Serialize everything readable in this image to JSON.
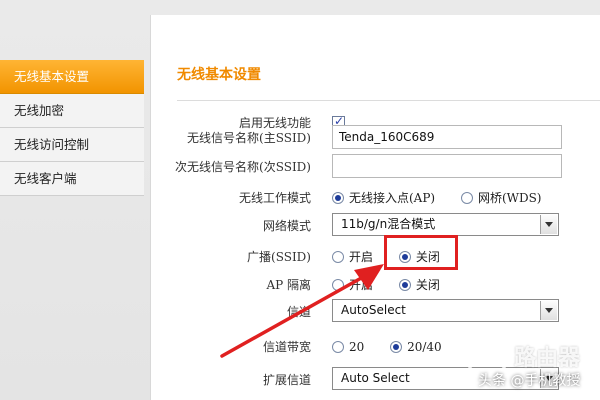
{
  "sidebar": {
    "items": [
      {
        "label": "无线基本设置",
        "active": true
      },
      {
        "label": "无线加密"
      },
      {
        "label": "无线访问控制"
      },
      {
        "label": "无线客户端"
      }
    ]
  },
  "main": {
    "title": "无线基本设置",
    "fields": {
      "enable_wireless": {
        "label": "启用无线功能",
        "checked": true
      },
      "ssid_primary": {
        "label": "无线信号名称(主SSID)",
        "value": "Tenda_160C689"
      },
      "ssid_secondary": {
        "label": "次无线信号名称(次SSID)",
        "value": ""
      },
      "work_mode": {
        "label": "无线工作模式",
        "options": [
          "无线接入点(AP)",
          "网桥(WDS)"
        ],
        "selected": "无线接入点(AP)"
      },
      "network_mode": {
        "label": "网络模式",
        "value": "11b/g/n混合模式"
      },
      "broadcast": {
        "label": "广播(SSID)",
        "options": [
          "开启",
          "关闭"
        ],
        "selected": "关闭"
      },
      "ap_isolation": {
        "label": "AP 隔离",
        "options": [
          "开启",
          "关闭"
        ],
        "selected": "关闭"
      },
      "channel": {
        "label": "信道",
        "value": "AutoSelect"
      },
      "bandwidth": {
        "label": "信道带宽",
        "options": [
          "20",
          "20/40"
        ],
        "selected": "20/40"
      },
      "ext_channel": {
        "label": "扩展信道",
        "value": "Auto Select"
      }
    }
  },
  "annotation": {
    "color": "#e02020"
  },
  "watermark": {
    "brand": "路由器",
    "footer": "头条 @手机教授"
  },
  "colors": {
    "accent": "#f29400",
    "title": "#f08a00"
  }
}
